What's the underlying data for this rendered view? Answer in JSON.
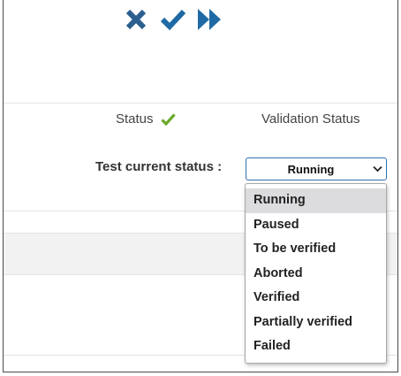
{
  "toolbar": {
    "icons": [
      "close-icon",
      "checkmark-icon",
      "fast-forward-icon"
    ],
    "accent_color": "#1f6aa5"
  },
  "header": {
    "status_label": "Status",
    "status_icon_color": "#6aaa2a",
    "validation_status_label": "Validation Status"
  },
  "test": {
    "current_status_label": "Test current status :",
    "selected": "Running",
    "options": [
      "Running",
      "Paused",
      "To be verified",
      "Aborted",
      "Verified",
      "Partially verified",
      "Failed"
    ],
    "highlighted_option": "Running"
  }
}
